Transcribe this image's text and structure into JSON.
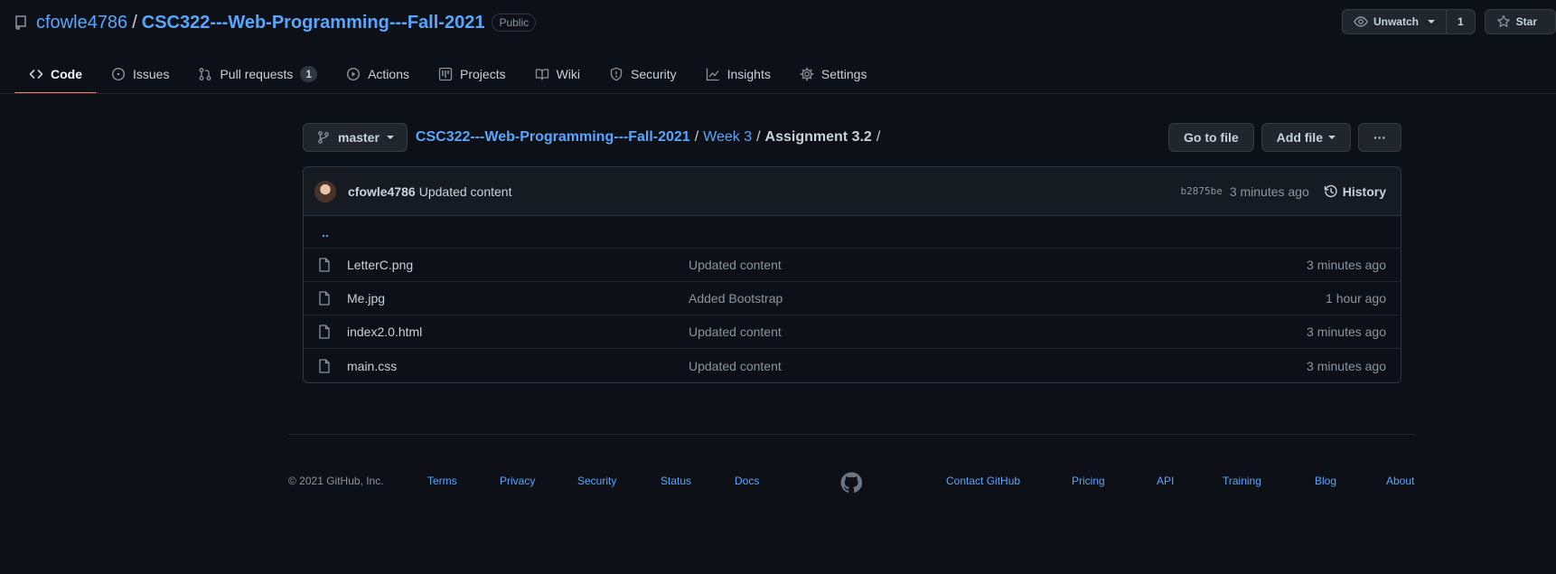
{
  "header": {
    "owner": "cfowle4786",
    "separator": "/",
    "repo": "CSC322---Web-Programming---Fall-2021",
    "visibility": "Public",
    "unwatch_label": "Unwatch",
    "watch_count": "1",
    "star_label": "Star"
  },
  "tabs": [
    {
      "label": "Code",
      "icon": "code-icon",
      "active": true
    },
    {
      "label": "Issues",
      "icon": "issue-icon"
    },
    {
      "label": "Pull requests",
      "icon": "pull-request-icon",
      "counter": "1"
    },
    {
      "label": "Actions",
      "icon": "play-icon"
    },
    {
      "label": "Projects",
      "icon": "project-icon"
    },
    {
      "label": "Wiki",
      "icon": "book-icon"
    },
    {
      "label": "Security",
      "icon": "shield-icon"
    },
    {
      "label": "Insights",
      "icon": "graph-icon"
    },
    {
      "label": "Settings",
      "icon": "gear-icon"
    }
  ],
  "breadcrumb": {
    "branch": "master",
    "repo": "CSC322---Web-Programming---Fall-2021",
    "folder": "Week 3",
    "current": "Assignment 3.2",
    "slash": "/",
    "go_to_file": "Go to file",
    "add_file": "Add file",
    "more": "···"
  },
  "commit": {
    "author": "cfowle4786",
    "message": "Updated content",
    "sha": "b2875be",
    "age": "3 minutes ago",
    "history_label": "History"
  },
  "up_link": "..",
  "files": [
    {
      "name": "LetterC.png",
      "message": "Updated content",
      "age": "3 minutes ago"
    },
    {
      "name": "Me.jpg",
      "message": "Added Bootstrap",
      "age": "1 hour ago"
    },
    {
      "name": "index2.0.html",
      "message": "Updated content",
      "age": "3 minutes ago"
    },
    {
      "name": "main.css",
      "message": "Updated content",
      "age": "3 minutes ago"
    }
  ],
  "footer": {
    "copyright": "© 2021 GitHub, Inc.",
    "links": [
      "Terms",
      "Privacy",
      "Security",
      "Status",
      "Docs",
      "Contact GitHub",
      "Pricing",
      "API",
      "Training",
      "Blog",
      "About"
    ]
  },
  "colors": {
    "background": "#0d1117",
    "link": "#58a6ff",
    "active_tab_underline": "#f78166",
    "muted_text": "#8b949e"
  }
}
